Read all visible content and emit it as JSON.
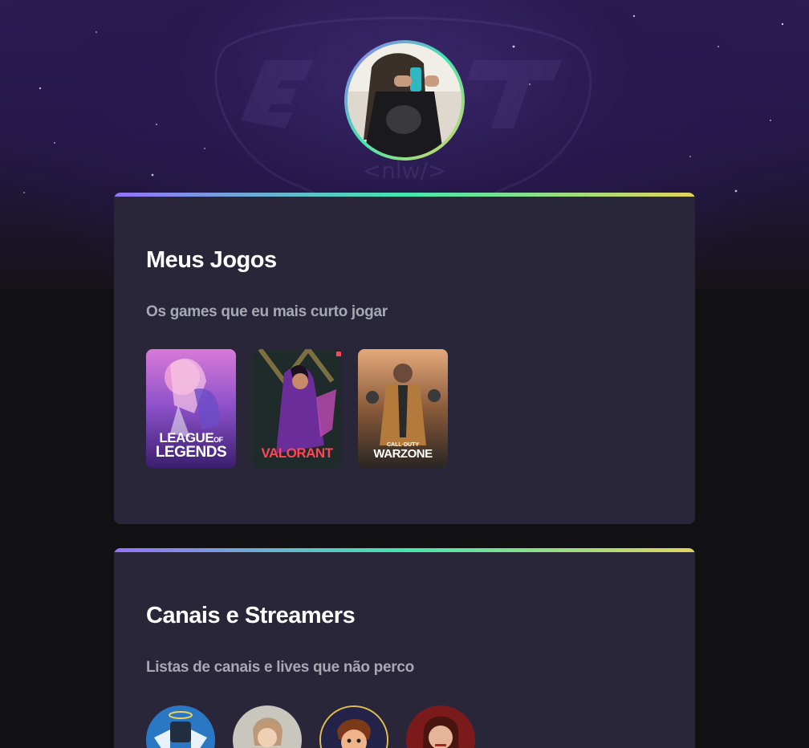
{
  "profile": {
    "avatar_alt": "Foto de perfil"
  },
  "games_section": {
    "title": "Meus Jogos",
    "subtitle": "Os games que eu mais curto jogar",
    "games": [
      {
        "logo_line1": "LEAGUE",
        "logo_of": "OF",
        "logo_line2": "LEGENDS"
      },
      {
        "logo_line1": "VALORANT"
      },
      {
        "logo_top": "CALL·DUTY",
        "logo_line1": "WARZONE"
      }
    ]
  },
  "streamers_section": {
    "title": "Canais e Streamers",
    "subtitle": "Listas de canais e lives que não perco"
  },
  "colors": {
    "background": "#121214",
    "card": "#29263a",
    "accent_start": "#9572fc",
    "accent_mid": "#43e7ad",
    "accent_end": "#e2d45c",
    "subtitle": "#a8a8b3"
  },
  "icons": [
    "avatar-photo",
    "game-cover-lol",
    "game-cover-valorant",
    "game-cover-warzone",
    "streamer-avatar"
  ]
}
